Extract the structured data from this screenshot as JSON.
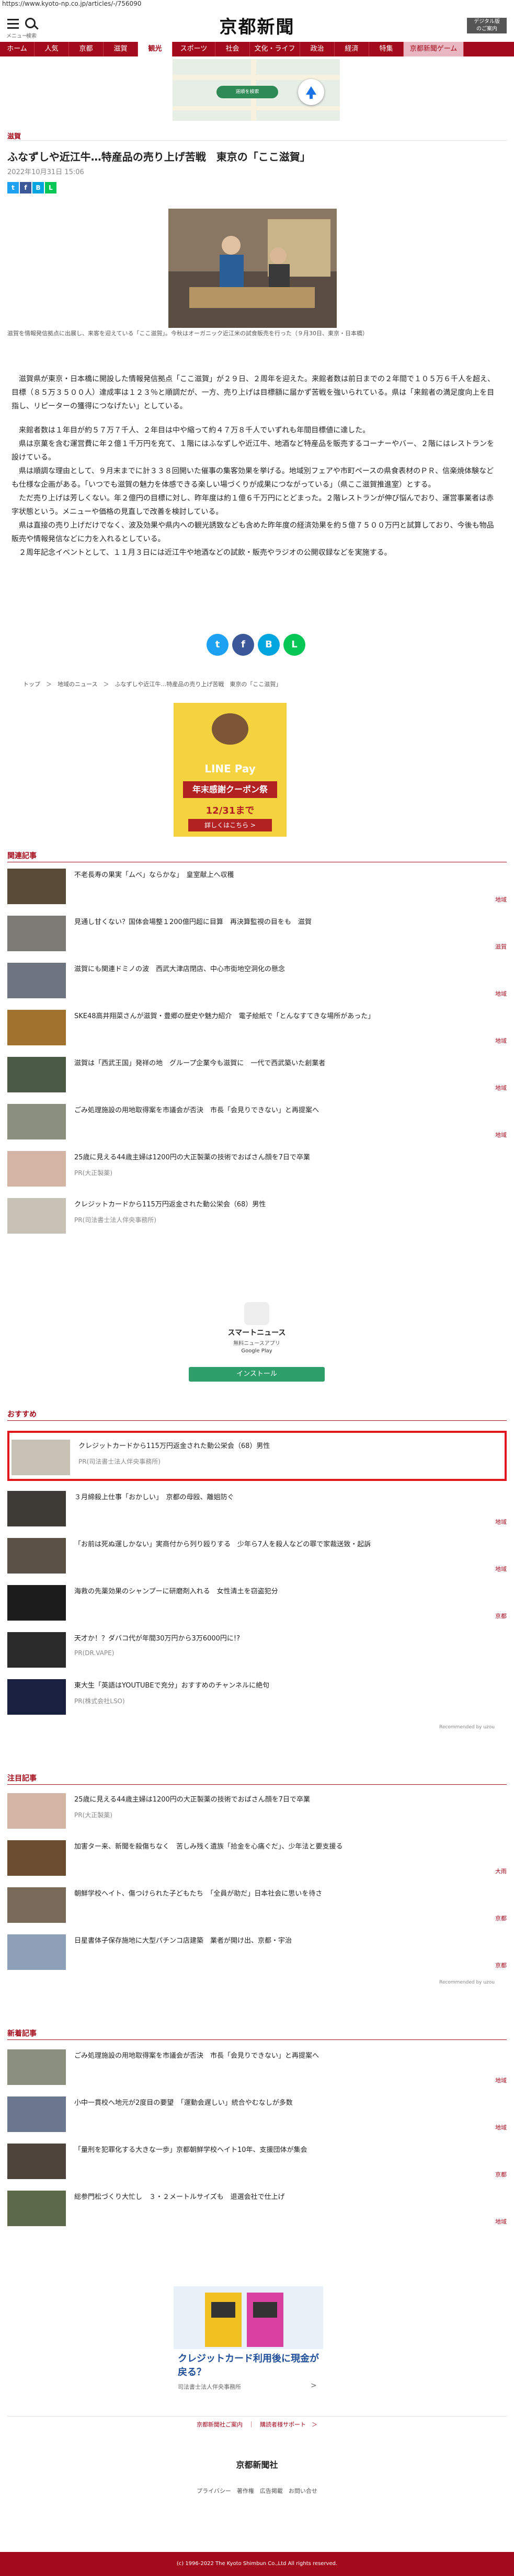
{
  "url": "https://www.kyoto-np.co.jp/articles/-/756090",
  "site_name": "京都新聞",
  "top": {
    "menu_label": "メニュー",
    "search_label": "検索",
    "register": "デジタル版\nのご案内"
  },
  "nav": [
    "ホーム",
    "人気",
    "京都",
    "滋賀",
    "観光",
    "スポーツ",
    "社会",
    "文化・ライフ",
    "政治",
    "経済",
    "特集",
    "京都新聞ゲーム"
  ],
  "map_ad": {
    "banner": "道順を検索"
  },
  "article": {
    "section": "滋賀",
    "title": "ふなずしや近江牛…特産品の売り上げ苦戦　東京の「ここ滋賀」",
    "date": "2022年10月31日 15:06",
    "caption": "滋賀を情報発信拠点に出展し、来客を迎えている「ここ滋賀」。今秋はオーガニック近江米の試食販売を行った（９月30日、東京・日本橋）",
    "paragraphs": [
      "　滋賀県が東京・日本橋に開設した情報発信拠点「ここ滋賀」が２９日、２周年を迎えた。来館者数は前日までの２年間で１０５万６千人を超え、目標（８５万３５００人）達成率は１２３％と順調だが、一方、売り上げは目標額に届かず苦戦を強いられている。県は「来館者の満足度向上を目指し、リピーターの獲得につなげたい」としている。",
      "",
      "　来館者数は１年目が約５７万７千人、２年目は中や縮って約４７万８千人でいずれも年間目標値に達した。",
      "　県は京菓を含む運営費に年２億１千万円を充て、１階にはふなずしや近江牛、地酒など特産品を販売するコーナーやバー、２階にはレストランを設けている。",
      "　県は順調な理由として、９月末までに計３３８回開いた催事の集客効果を挙げる。地域別フェアや市町ペースの県食表材のＰＲ、信楽焼体験なども仕様な企画がある。「いつでも滋賀の魅力を体感できる楽しい場づくりが成果につながっている」（県ここ滋賀推進室）とする。",
      "　ただ売り上げは芳しくない。年２億円の目標に対し、昨年度は約１億６千万円にとどまった。２階レストランが伸び悩んでおり、運営事業者は赤字状態という。メニューや価格の見直しで改善を検討している。",
      "　県は直接の売り上げだけでなく、波及効果や県内への観光誘致なども含めた昨年度の経済効果を約５億７５００万円と試算しており、今後も物品販売や情報発信などに力を入れるとしている。",
      "　２周年記念イベントとして、１１月３日には近江牛や地酒などの試飲・販売やラジオの公開収録などを実施する。"
    ],
    "breadcrumb": "トップ　＞　地域のニュース　＞　ふなずしや近江牛…特産品の売り上げ苦戦　東京の「ここ滋賀」"
  },
  "ad_line": {
    "brand": "LINE Pay",
    "headline": "年末感謝クーポン祭",
    "period": "12/31まで",
    "button": "詳しくはこちら >"
  },
  "related": {
    "header": "関連記事",
    "items": [
      {
        "text": "不老長寿の果実「ムベ」ならかな」　皇室献上へ収穫",
        "tag": "地域"
      },
      {
        "text": "見通し甘くない？国体会場整１200億円超に目算　再決算監視の目をも　滋賀",
        "tag": "滋賀"
      },
      {
        "text": "滋賀にも関連ドミノの波　西武大津店閉店、中心市街地空洞化の懸念",
        "tag": "地域"
      },
      {
        "text": "SKE48高井翔菜さんが滋賀・豊郷の歴史や魅力紹介　電子絵紙で「とんなすてきな場所があった」",
        "tag": "地域"
      },
      {
        "text": "滋賀は「西武王国」発祥の地　グループ企業今も滋賀に　一代で西武築いた創業者",
        "tag": "地域"
      },
      {
        "text": "ごみ処理施設の用地取得案を市議会が否決　市長「会見りできない」と再提案へ",
        "tag": "地域"
      },
      {
        "text": "25歳に見える44歳主婦は1200円の大正製薬の技術でおばさん顔を7日で卒業",
        "pr": "PR(大正製薬)"
      },
      {
        "text": "クレジットカードから115万円返金された動公栄会（68）男性",
        "pr": "PR(司法書士法人伴央事務所)"
      }
    ]
  },
  "app_ad": {
    "title": "スマートニュース",
    "sub": "無料ニュースアプリ",
    "store": "Google Play",
    "button": "インストール"
  },
  "osusume": {
    "header": "おすすめ",
    "items": [
      {
        "text": "クレジットカードから115万円返金された動公栄会（68）男性",
        "pr": "PR(司法書士法人伴央事務所)"
      },
      {
        "text": "３月締殺上仕事「おかしい」　京都の母殴、離姐防ぐ",
        "tag": "地域"
      },
      {
        "text": "「お前は死ぬ運しかない」実商付から列り殴りする　少年ら7人を殺人などの罪で家裁送致・起訴",
        "tag": "地域"
      },
      {
        "text": "海救の先薬効果のシャンプーに研磨剤入れる　女性清土を窃盗犯分",
        "tag": "京都"
      },
      {
        "text": "天才か！？ダバコ代が年間30万円から3万6000円に!?",
        "pr": "PR(DR.VAPE)"
      },
      {
        "text": "東大生「英語はYOUTUBEで充分」おすすめのチャンネルに絶句",
        "pr": "PR(株式会社LSO)"
      }
    ],
    "recommended": "Recommended by uzou"
  },
  "chumoku": {
    "header": "注目記事",
    "items": [
      {
        "text": "25歳に見える44歳主婦は1200円の大正製薬の技術でおばさん顔を7日で卒業",
        "pr": "PR(大正製薬)"
      },
      {
        "text": "加害ター来、新聞を殺傷ちなく　苦しみ残く遺族「拾金を心痛ぐだ」、少年法と要支援る",
        "tag": "大雨"
      },
      {
        "text": "朝鮮学校ヘイト、傷つけられた子どもたち　「全員が助だ」日本社会に思いを待さ",
        "tag": "京都"
      },
      {
        "text": "日星書体子保存施地に大型パチンコ店建築　業者が開け出、京都・宇治",
        "tag": "京都"
      }
    ],
    "recommended": "Recommended by uzou"
  },
  "shinchaku": {
    "header": "新着記事",
    "items": [
      {
        "text": "ごみ処理施設の用地取得案を市議会が否決　市長「会見りできない」と再提案へ",
        "tag": "地域"
      },
      {
        "text": "小中一貫校へ地元が2度目の要望　「運動会遅しい」統合やむなしが多数",
        "tag": "地域"
      },
      {
        "text": "「量刑を犯罪化する大きな一歩」京都朝鮮学校ヘイト10年、支援団体が集会",
        "tag": "京都"
      },
      {
        "text": "総参門松づくり大忙し　３・２メートルサイズも　退選会社で仕上げ",
        "tag": "地域"
      }
    ]
  },
  "ad_credit": {
    "headline": "クレジットカード利用後に現金が戻る？",
    "sub": "司法書士法人伴央事務所",
    "arrow": ">"
  },
  "footer_links": "京都新聞社ご案内　｜　購読者様サポート　＞",
  "footer_logo": "京都新聞社",
  "footer_nav": "プライバシー　著作権　広告掲載　お問い合せ",
  "copyright": "(c) 1996-2022 The Kyoto Shimbun Co.,Ltd All rights reserved."
}
